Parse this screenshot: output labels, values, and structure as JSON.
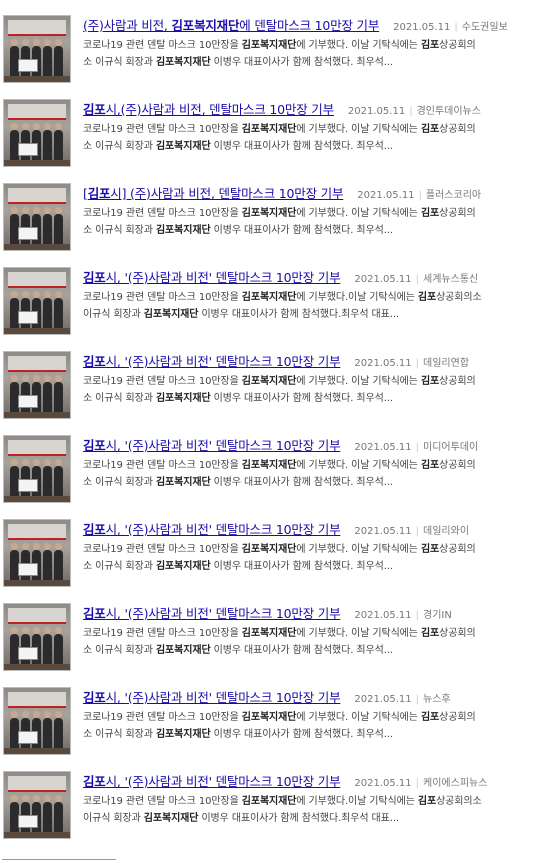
{
  "results": [
    {
      "title_parts": [
        {
          "text": "(주)사람과 비전, ",
          "bold": false
        },
        {
          "text": "김포복지재단",
          "bold": true
        },
        {
          "text": "에 덴탈마스크 10만장 기부",
          "bold": false
        }
      ],
      "date": "2021.05.11",
      "source": "수도권일보",
      "snippet_line1": [
        {
          "text": "코로나19 관련 덴탈 마스크 10만장을 ",
          "bold": false
        },
        {
          "text": "김포복지재단",
          "bold": true
        },
        {
          "text": "에 기부했다. 이날 기탁식에는 ",
          "bold": false
        },
        {
          "text": "김포",
          "bold": true
        },
        {
          "text": "상공회의",
          "bold": false
        }
      ],
      "snippet_line2": [
        {
          "text": "소 이규식 회장과 ",
          "bold": false
        },
        {
          "text": "김포복지재단",
          "bold": true
        },
        {
          "text": " 이병우 대표이사가 함께 참석했다. 최우석...",
          "bold": false
        }
      ]
    },
    {
      "title_parts": [
        {
          "text": "김포",
          "bold": true
        },
        {
          "text": "시,(주)사람과 비전, 덴탈마스크 10만장 기부",
          "bold": false
        }
      ],
      "date": "2021.05.11",
      "source": "경인투데이뉴스",
      "snippet_line1": [
        {
          "text": "코로나19 관련 덴탈 마스크 10만장을 ",
          "bold": false
        },
        {
          "text": "김포복지재단",
          "bold": true
        },
        {
          "text": "에 기부했다. 이날 기탁식에는 ",
          "bold": false
        },
        {
          "text": "김포",
          "bold": true
        },
        {
          "text": "상공회의",
          "bold": false
        }
      ],
      "snippet_line2": [
        {
          "text": "소 이규식 회장과 ",
          "bold": false
        },
        {
          "text": "김포복지재단",
          "bold": true
        },
        {
          "text": " 이병우 대표이사가 함께 참석했다. 최우석...",
          "bold": false
        }
      ]
    },
    {
      "title_parts": [
        {
          "text": "[",
          "bold": false
        },
        {
          "text": "김포",
          "bold": true
        },
        {
          "text": "시] (주)사람과 비전, 덴탈마스크 10만장 기부",
          "bold": false
        }
      ],
      "date": "2021.05.11",
      "source": "플러스코리아",
      "snippet_line1": [
        {
          "text": "코로나19 관련 덴탈 마스크 10만장을 ",
          "bold": false
        },
        {
          "text": "김포복지재단",
          "bold": true
        },
        {
          "text": "에 기부했다. 이날 기탁식에는 ",
          "bold": false
        },
        {
          "text": "김포",
          "bold": true
        },
        {
          "text": "상공회의",
          "bold": false
        }
      ],
      "snippet_line2": [
        {
          "text": "소 이규식 회장과 ",
          "bold": false
        },
        {
          "text": "김포복지재단",
          "bold": true
        },
        {
          "text": " 이병우 대표이사가 함께 참석했다. 최우석...",
          "bold": false
        }
      ]
    },
    {
      "title_parts": [
        {
          "text": "김포",
          "bold": true
        },
        {
          "text": "시, '(주)사람과 비전' 덴탈마스크 10만장 기부",
          "bold": false
        }
      ],
      "date": "2021.05.11",
      "source": "세계뉴스통신",
      "snippet_line1": [
        {
          "text": "코로나19 관련 덴탈 마스크 10만장을 ",
          "bold": false
        },
        {
          "text": "김포복지재단",
          "bold": true
        },
        {
          "text": "에 기부했다.이날 기탁식에는 ",
          "bold": false
        },
        {
          "text": "김포",
          "bold": true
        },
        {
          "text": "상공회의소",
          "bold": false
        }
      ],
      "snippet_line2": [
        {
          "text": "이규식 회장과 ",
          "bold": false
        },
        {
          "text": "김포복지재단",
          "bold": true
        },
        {
          "text": " 이병우 대표이사가 함께 참석했다.최우석 대표...",
          "bold": false
        }
      ]
    },
    {
      "title_parts": [
        {
          "text": "김포",
          "bold": true
        },
        {
          "text": "시, '(주)사람과 비전' 덴탈마스크 10만장 기부",
          "bold": false
        }
      ],
      "date": "2021.05.11",
      "source": "데일리연합",
      "snippet_line1": [
        {
          "text": "코로나19 관련 덴탈 마스크 10만장을 ",
          "bold": false
        },
        {
          "text": "김포복지재단",
          "bold": true
        },
        {
          "text": "에 기부했다. 이날 기탁식에는 ",
          "bold": false
        },
        {
          "text": "김포",
          "bold": true
        },
        {
          "text": "상공회의",
          "bold": false
        }
      ],
      "snippet_line2": [
        {
          "text": "소 이규식 회장과 ",
          "bold": false
        },
        {
          "text": "김포복지재단",
          "bold": true
        },
        {
          "text": " 이병우 대표이사가 함께 참석했다. 최우석...",
          "bold": false
        }
      ]
    },
    {
      "title_parts": [
        {
          "text": "김포",
          "bold": true
        },
        {
          "text": "시, '(주)사람과 비전' 덴탈마스크 10만장 기부",
          "bold": false
        }
      ],
      "date": "2021.05.11",
      "source": "미디어투데이",
      "snippet_line1": [
        {
          "text": "코로나19 관련 덴탈 마스크 10만장을 ",
          "bold": false
        },
        {
          "text": "김포복지재단",
          "bold": true
        },
        {
          "text": "에 기부했다. 이날 기탁식에는 ",
          "bold": false
        },
        {
          "text": "김포",
          "bold": true
        },
        {
          "text": "상공회의",
          "bold": false
        }
      ],
      "snippet_line2": [
        {
          "text": "소 이규식 회장과 ",
          "bold": false
        },
        {
          "text": "김포복지재단",
          "bold": true
        },
        {
          "text": " 이병우 대표이사가 함께 참석했다. 최우석...",
          "bold": false
        }
      ]
    },
    {
      "title_parts": [
        {
          "text": "김포",
          "bold": true
        },
        {
          "text": "시, '(주)사람과 비전' 덴탈마스크 10만장 기부",
          "bold": false
        }
      ],
      "date": "2021.05.11",
      "source": "데일리와이",
      "snippet_line1": [
        {
          "text": "코로나19 관련 덴탈 마스크 10만장을 ",
          "bold": false
        },
        {
          "text": "김포복지재단",
          "bold": true
        },
        {
          "text": "에 기부했다. 이날 기탁식에는 ",
          "bold": false
        },
        {
          "text": "김포",
          "bold": true
        },
        {
          "text": "상공회의",
          "bold": false
        }
      ],
      "snippet_line2": [
        {
          "text": "소 이규식 회장과 ",
          "bold": false
        },
        {
          "text": "김포복지재단",
          "bold": true
        },
        {
          "text": " 이병우 대표이사가 함께 참석했다. 최우석...",
          "bold": false
        }
      ]
    },
    {
      "title_parts": [
        {
          "text": "김포",
          "bold": true
        },
        {
          "text": "시, '(주)사람과 비전' 덴탈마스크 10만장 기부",
          "bold": false
        }
      ],
      "date": "2021.05.11",
      "source": "경기IN",
      "snippet_line1": [
        {
          "text": "코로나19 관련 덴탈 마스크 10만장을 ",
          "bold": false
        },
        {
          "text": "김포복지재단",
          "bold": true
        },
        {
          "text": "에 기부했다. 이날 기탁식에는 ",
          "bold": false
        },
        {
          "text": "김포",
          "bold": true
        },
        {
          "text": "상공회의",
          "bold": false
        }
      ],
      "snippet_line2": [
        {
          "text": "소 이규식 회장과 ",
          "bold": false
        },
        {
          "text": "김포복지재단",
          "bold": true
        },
        {
          "text": " 이병우 대표이사가 함께 참석했다. 최우석...",
          "bold": false
        }
      ]
    },
    {
      "title_parts": [
        {
          "text": "김포",
          "bold": true
        },
        {
          "text": "시, '(주)사람과 비전' 덴탈마스크 10만장 기부",
          "bold": false
        }
      ],
      "date": "2021.05.11",
      "source": "뉴스후",
      "snippet_line1": [
        {
          "text": "코로나19 관련 덴탈 마스크 10만장을 ",
          "bold": false
        },
        {
          "text": "김포복지재단",
          "bold": true
        },
        {
          "text": "에 기부했다. 이날 기탁식에는 ",
          "bold": false
        },
        {
          "text": "김포",
          "bold": true
        },
        {
          "text": "상공회의",
          "bold": false
        }
      ],
      "snippet_line2": [
        {
          "text": "소 이규식 회장과 ",
          "bold": false
        },
        {
          "text": "김포복지재단",
          "bold": true
        },
        {
          "text": " 이병우 대표이사가 함께 참석했다. 최우석...",
          "bold": false
        }
      ]
    },
    {
      "title_parts": [
        {
          "text": "김포",
          "bold": true
        },
        {
          "text": "시, '(주)사람과 비전' 덴탈마스크 10만장 기부",
          "bold": false
        }
      ],
      "date": "2021.05.11",
      "source": "케이에스피뉴스",
      "snippet_line1": [
        {
          "text": "코로나19 관련 덴탈 마스크 10만장을 ",
          "bold": false
        },
        {
          "text": "김포복지재단",
          "bold": true
        },
        {
          "text": "에 기부했다.이날 기탁식에는 ",
          "bold": false
        },
        {
          "text": "김포",
          "bold": true
        },
        {
          "text": "상공회의소",
          "bold": false
        }
      ],
      "snippet_line2": [
        {
          "text": "이규식 회장과 ",
          "bold": false
        },
        {
          "text": "김포복지재단",
          "bold": true
        },
        {
          "text": " 이병우 대표이사가 함께 참석했다.최우석 대표...",
          "bold": false
        }
      ]
    }
  ],
  "colors": {
    "title_link": "#1a0dab",
    "meta_text": "#777777",
    "snippet_text": "#444444"
  }
}
